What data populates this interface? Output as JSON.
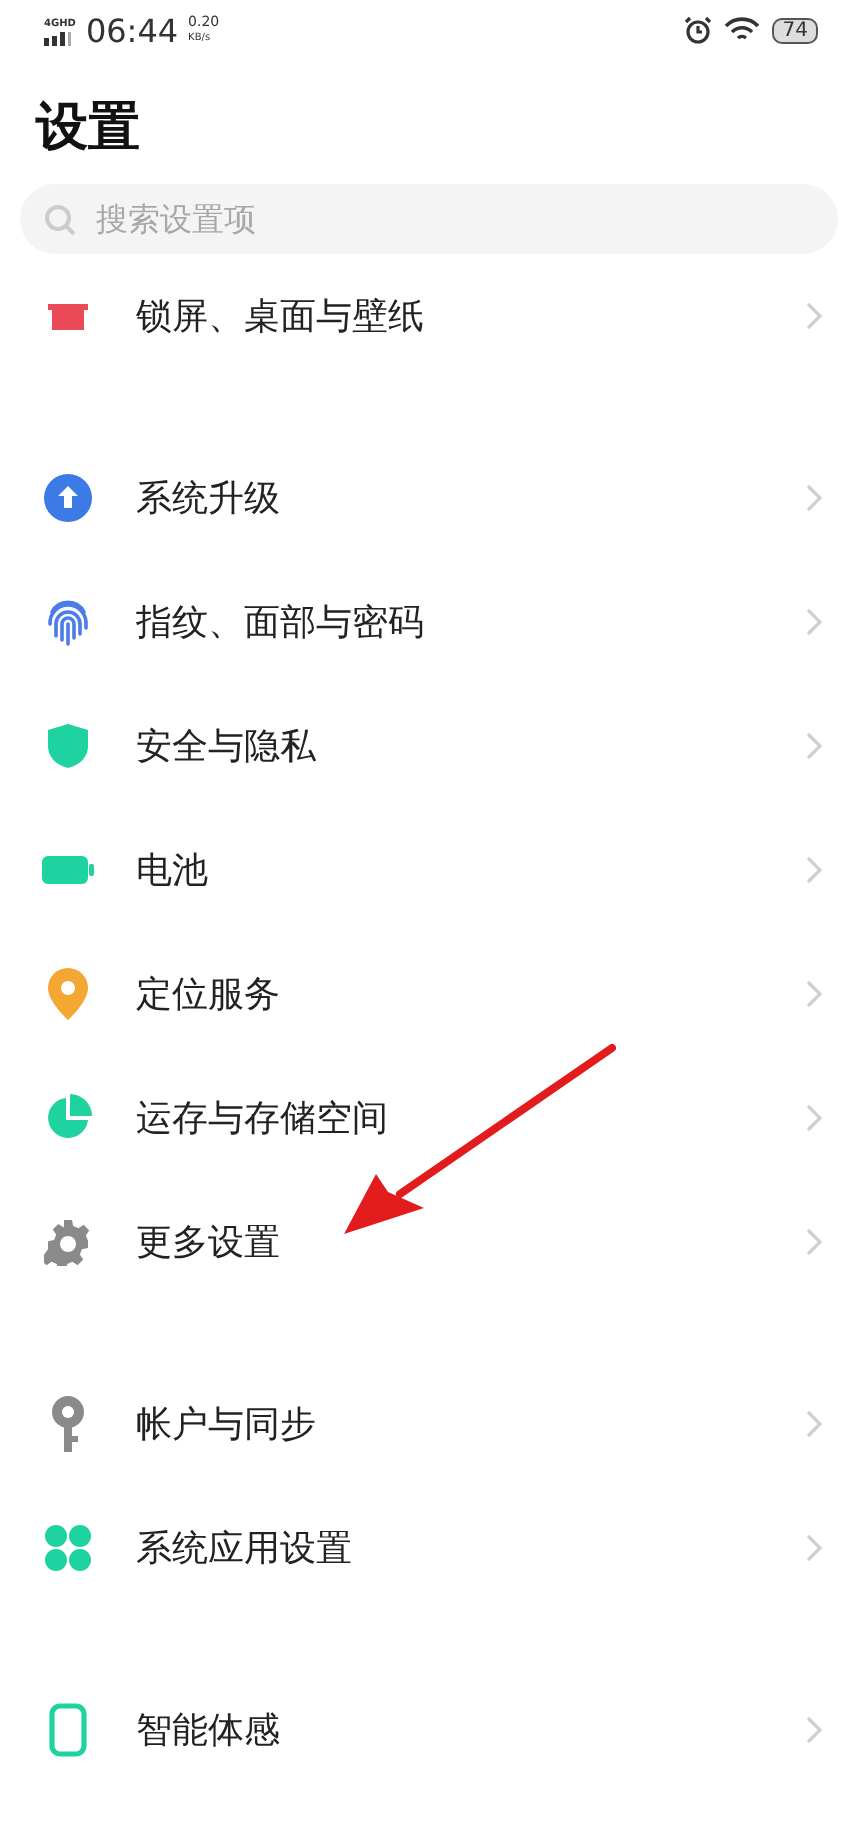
{
  "status_bar": {
    "network": "4G",
    "network_sub": "HD",
    "time": "06:44",
    "speed": "0.20",
    "speed_unit": "KB/s",
    "battery": "74"
  },
  "title": "设置",
  "search": {
    "placeholder": "搜索设置项"
  },
  "groups": [
    {
      "items": [
        {
          "label": "锁屏、桌面与壁纸"
        }
      ]
    },
    {
      "items": [
        {
          "label": "系统升级"
        },
        {
          "label": "指纹、面部与密码"
        },
        {
          "label": "安全与隐私"
        },
        {
          "label": "电池"
        },
        {
          "label": "定位服务"
        },
        {
          "label": "运存与存储空间"
        },
        {
          "label": "更多设置"
        }
      ]
    },
    {
      "items": [
        {
          "label": "帐户与同步"
        },
        {
          "label": "系统应用设置"
        }
      ]
    },
    {
      "items": [
        {
          "label": "智能体感"
        }
      ]
    }
  ],
  "annotation": {
    "kind": "arrow"
  }
}
